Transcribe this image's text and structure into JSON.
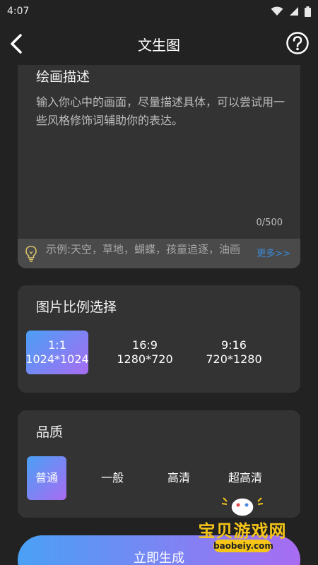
{
  "status_bar": {
    "time": "4:07"
  },
  "header": {
    "title": "文生图"
  },
  "description": {
    "title": "绘画描述",
    "placeholder": "输入你心中的画面，尽量描述具体，可以尝试用一些风格修饰词辅助你的表达。",
    "counter": "0/500",
    "example_text": "示例:天空，草地，蝴蝶，孩童追逐，油画",
    "more_label": "更多>>"
  },
  "ratio": {
    "title": "图片比例选择",
    "options": [
      {
        "ratio": "1:1",
        "size": "1024*1024",
        "selected": true
      },
      {
        "ratio": "16:9",
        "size": "1280*720",
        "selected": false
      },
      {
        "ratio": "9:16",
        "size": "720*1280",
        "selected": false
      }
    ]
  },
  "quality": {
    "title": "品质",
    "options": [
      {
        "label": "普通",
        "selected": true
      },
      {
        "label": "一般",
        "selected": false
      },
      {
        "label": "高清",
        "selected": false
      },
      {
        "label": "超高清",
        "selected": false
      }
    ]
  },
  "generate_button": {
    "label": "立即生成"
  },
  "watermark": {
    "text": "宝贝游戏网",
    "url": "baobeiy.com"
  },
  "colors": {
    "background": "#222222",
    "card": "#333333",
    "accent_start": "#4aa0f5",
    "accent_end": "#a86cf2",
    "link": "#3b8ad6"
  },
  "icons": [
    "back-arrow-icon",
    "help-icon",
    "wifi-icon",
    "signal-icon",
    "battery-icon",
    "lightbulb-icon"
  ]
}
